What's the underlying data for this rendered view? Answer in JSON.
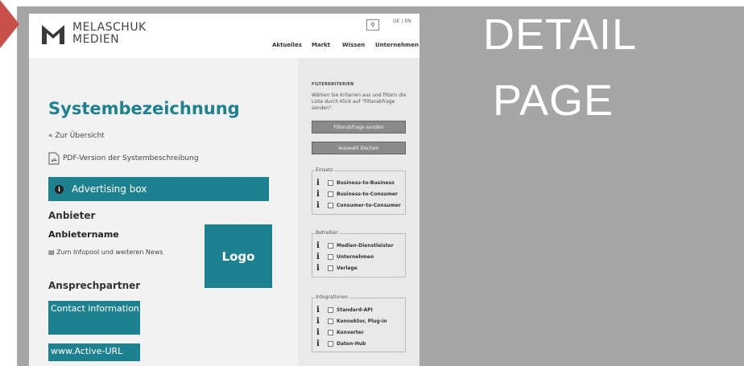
{
  "brand": {
    "line1": "MELASCHUK",
    "line2": "MEDIEN"
  },
  "header": {
    "search_icon": "search-icon",
    "lang": "DE | EN",
    "nav": [
      "Aktuelles",
      "Markt",
      "Wissen",
      "Unternehmen"
    ]
  },
  "main": {
    "title": "Systembezeichnung",
    "back": "« Zur Übersicht",
    "pdf": "PDF-Version der Systembeschreibung",
    "adbox": "Advertising box",
    "anbieter_heading": "Anbieter",
    "anbieter_name": "Anbietername",
    "infopool": "Zum Infopool und weiteren News",
    "logo": "Logo",
    "contact_heading": "Ansprechpartner",
    "contact_box": "Contact information",
    "url": "www.Active-URL"
  },
  "sidebar": {
    "title": "FILTERKRITERIEN",
    "desc": "Wählen Sie Kriterien aus und filtern die Liste durch Klick auf \"Filterabfrage senden\".",
    "send_button": "Filterabfrage senden",
    "clear_button": "Auswahl löschen",
    "groups": [
      {
        "legend": "Einsatz",
        "options": [
          "Business-to-Business",
          "Business-to-Consumer",
          "Consumer-to-Consumer"
        ]
      },
      {
        "legend": "Betreiber",
        "options": [
          "Medien-Dienstleister",
          "Unternehmen",
          "Verlage"
        ]
      },
      {
        "legend": "Integrationen",
        "options": [
          "Standard-API",
          "Konnektor, Plug-in",
          "Konverter",
          "Daten-Hub"
        ]
      }
    ]
  },
  "overlay": {
    "line1": "DETAIL",
    "line2": "PAGE"
  },
  "colors": {
    "teal": "#1e8190",
    "frame": "#a6a6a6",
    "corner": "#c8504a"
  }
}
